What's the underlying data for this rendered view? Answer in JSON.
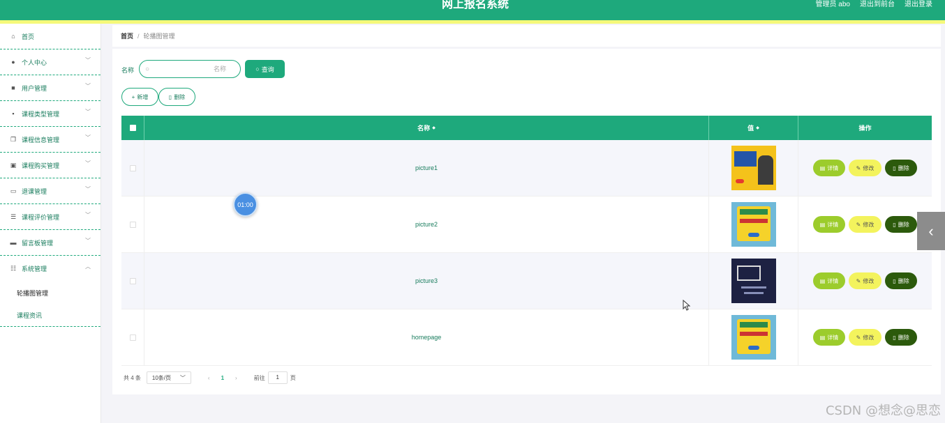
{
  "header": {
    "title": "网上报名系统",
    "admin_label": "管理员 abo",
    "to_front_label": "退出到前台",
    "logout_label": "退出登录"
  },
  "sidebar": {
    "items": [
      {
        "label": "首页",
        "icon": "home-icon",
        "has_children": false
      },
      {
        "label": "个人中心",
        "icon": "user-icon",
        "has_children": true
      },
      {
        "label": "用户管理",
        "icon": "users-icon",
        "has_children": true
      },
      {
        "label": "课程类型管理",
        "icon": "chat-icon",
        "has_children": true
      },
      {
        "label": "课程信息管理",
        "icon": "copy-icon",
        "has_children": true
      },
      {
        "label": "课程购买管理",
        "icon": "clipboard-icon",
        "has_children": true
      },
      {
        "label": "退课管理",
        "icon": "message-icon",
        "has_children": true
      },
      {
        "label": "课程评价管理",
        "icon": "list-icon",
        "has_children": true
      },
      {
        "label": "留言板管理",
        "icon": "printer-icon",
        "has_children": true
      },
      {
        "label": "系统管理",
        "icon": "sliders-icon",
        "has_children": true,
        "expanded": true
      }
    ],
    "sub_items": [
      {
        "label": "轮播图管理",
        "active": true
      },
      {
        "label": "课程资讯",
        "active": false
      }
    ]
  },
  "breadcrumb": {
    "home": "首页",
    "separator": "/",
    "current": "轮播图管理"
  },
  "search": {
    "label": "名称",
    "placeholder": "名称",
    "query_button": "查询"
  },
  "actions": {
    "add_label": "新增",
    "delete_label": "删除"
  },
  "table": {
    "columns": [
      "名称",
      "值",
      "操作"
    ],
    "rows": [
      {
        "name": "picture1",
        "thumb": "yellow"
      },
      {
        "name": "picture2",
        "thumb": "colorful"
      },
      {
        "name": "picture3",
        "thumb": "dark"
      },
      {
        "name": "homepage",
        "thumb": "colorful"
      }
    ],
    "op_labels": {
      "detail": "详情",
      "edit": "修改",
      "delete": "删除"
    }
  },
  "pagination": {
    "total": "共 4 条",
    "page_size": "10条/页",
    "current_page": "1",
    "goto_label": "前往",
    "goto_value": "1",
    "page_unit": "页"
  },
  "timer": "01:00",
  "watermark": "CSDN @想念@思恋",
  "colors": {
    "primary": "#1ea97c",
    "accent_yellow": "#f5f97a",
    "detail": "#9ccc2c",
    "edit": "#f3f35d",
    "delete": "#2c5a0c"
  }
}
